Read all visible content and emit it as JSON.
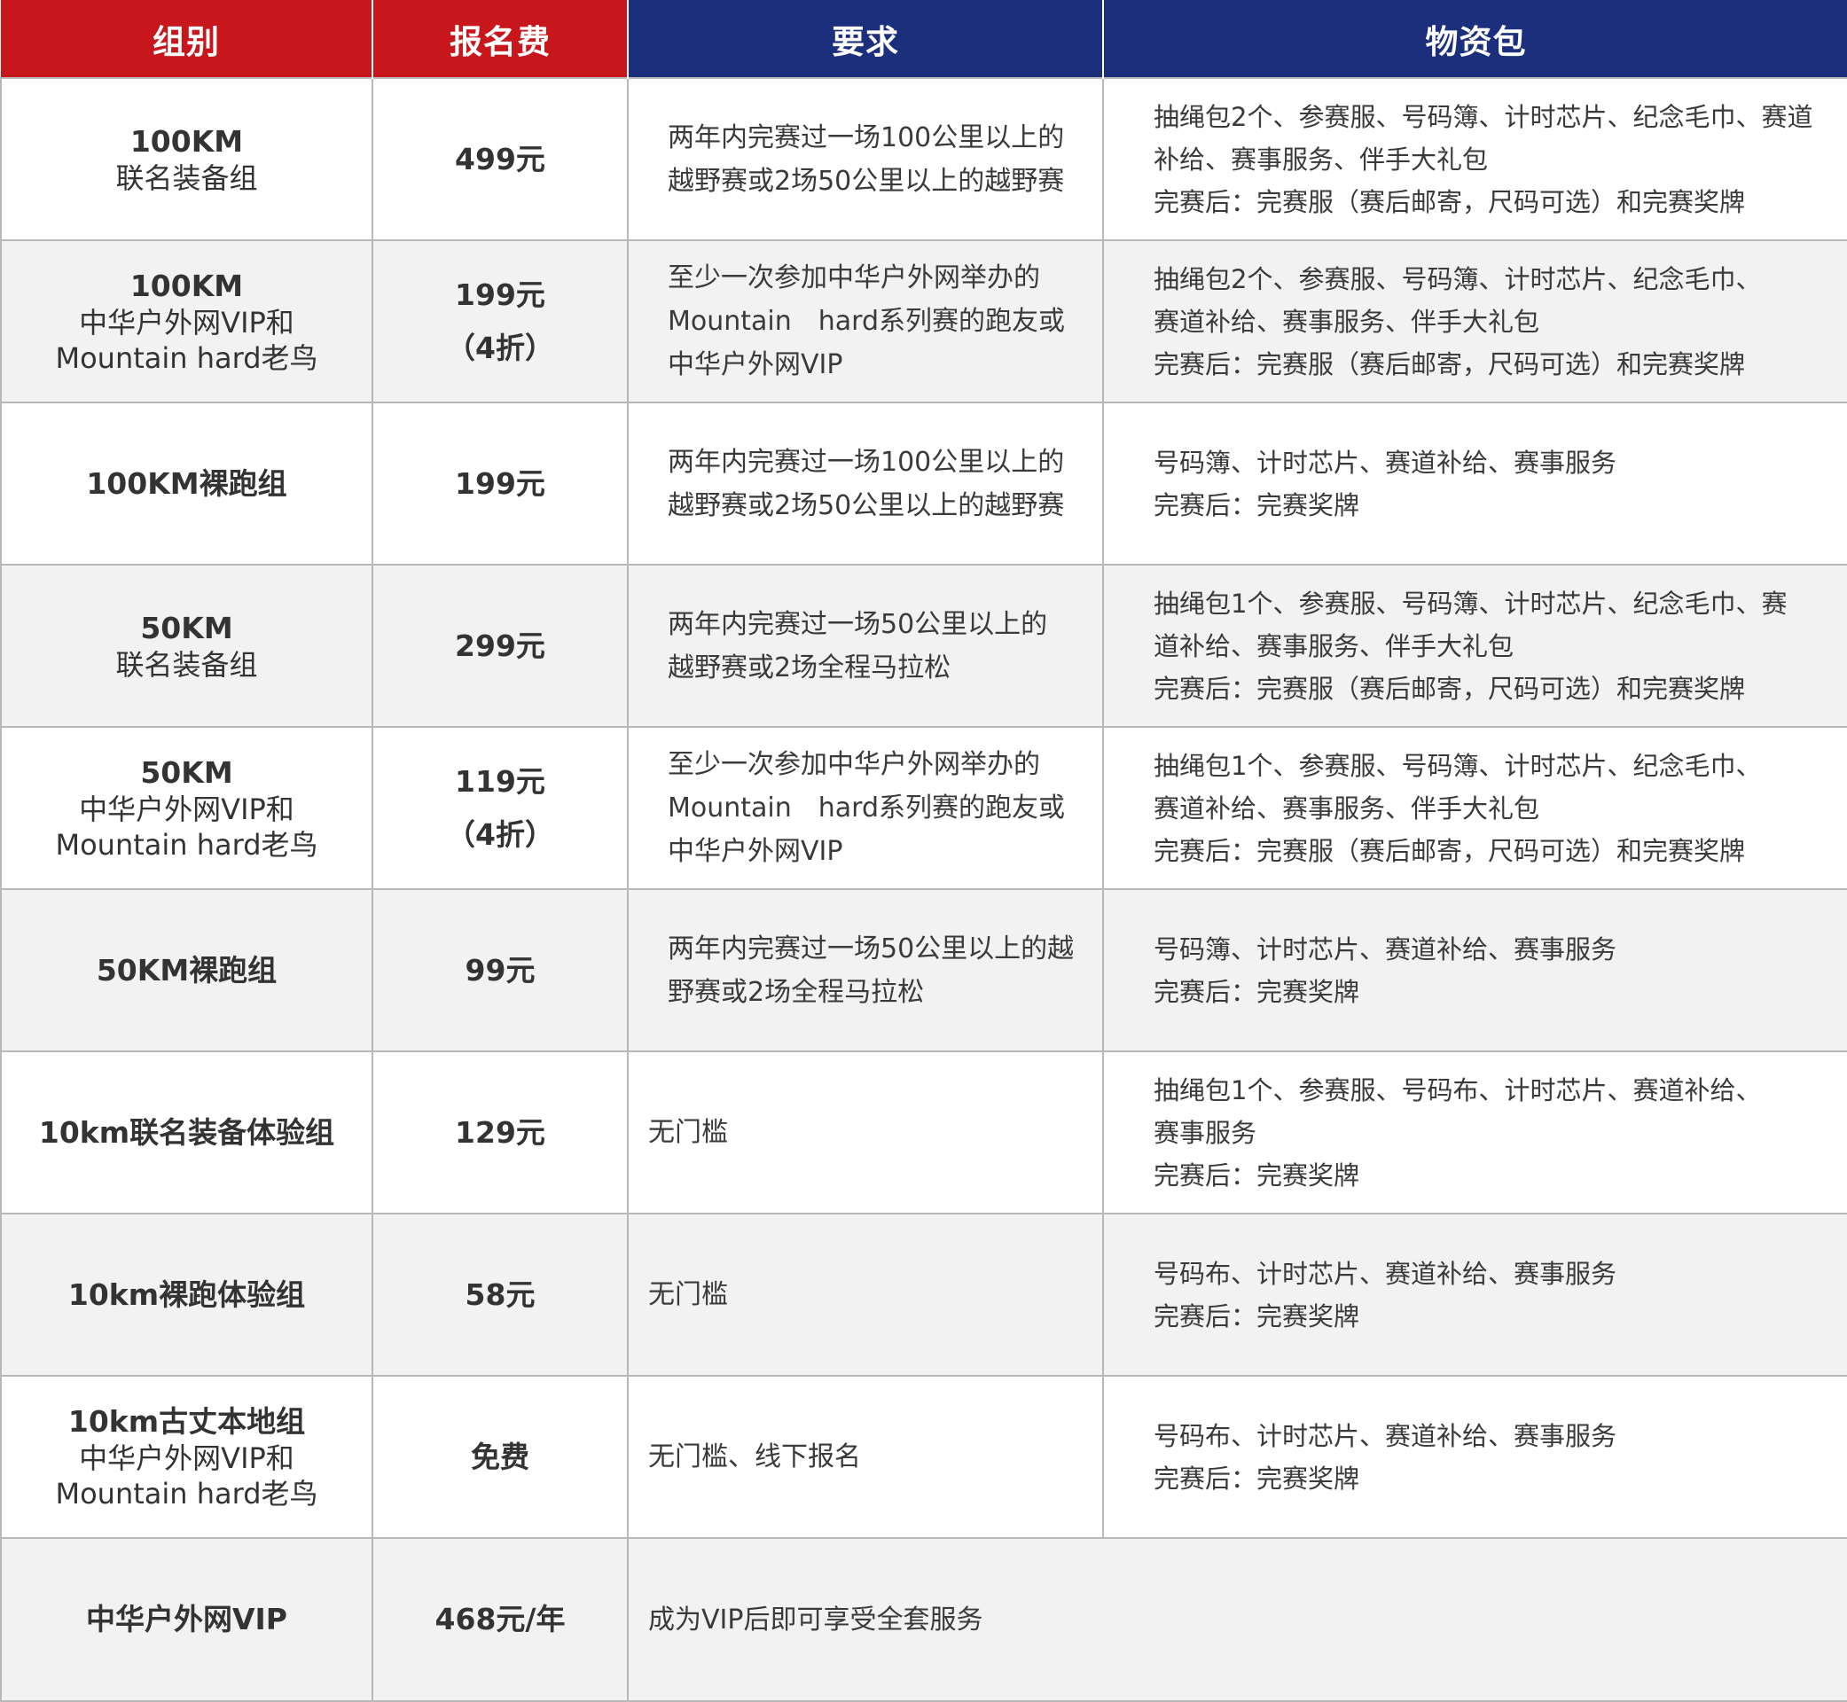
{
  "headers": {
    "group": "组别",
    "fee": "报名费",
    "requirement": "要求",
    "kit": "物资包"
  },
  "rows": [
    {
      "group": [
        "100KM",
        "联名装备组"
      ],
      "fee": [
        "499元"
      ],
      "requirement": [
        "两年内完赛过一场100公里以上的",
        "越野赛或2场50公里以上的越野赛"
      ],
      "kit": [
        "抽绳包2个、参赛服、号码簿、计时芯片、纪念毛巾、赛道",
        "补给、赛事服务、伴手大礼包",
        "完赛后：完赛服（赛后邮寄，尺码可选）和完赛奖牌"
      ]
    },
    {
      "group": [
        "100KM",
        "中华户外网VIP和",
        "Mountain hard老鸟"
      ],
      "fee": [
        "199元",
        "（4折）"
      ],
      "requirement": [
        "至少一次参加中华户外网举办的",
        "Mountain　hard系列赛的跑友或",
        "中华户外网VIP"
      ],
      "kit": [
        "抽绳包2个、参赛服、号码簿、计时芯片、纪念毛巾、",
        "赛道补给、赛事服务、伴手大礼包",
        "完赛后：完赛服（赛后邮寄，尺码可选）和完赛奖牌"
      ]
    },
    {
      "group": [
        "100KM裸跑组"
      ],
      "fee": [
        "199元"
      ],
      "requirement": [
        "两年内完赛过一场100公里以上的",
        "越野赛或2场50公里以上的越野赛"
      ],
      "kit": [
        "号码簿、计时芯片、赛道补给、赛事服务",
        "完赛后：完赛奖牌"
      ]
    },
    {
      "group": [
        "50KM",
        "联名装备组"
      ],
      "fee": [
        "299元"
      ],
      "requirement": [
        "两年内完赛过一场50公里以上的",
        "越野赛或2场全程马拉松"
      ],
      "kit": [
        "抽绳包1个、参赛服、号码簿、计时芯片、纪念毛巾、赛",
        "道补给、赛事服务、伴手大礼包",
        "完赛后：完赛服（赛后邮寄，尺码可选）和完赛奖牌"
      ]
    },
    {
      "group": [
        "50KM",
        "中华户外网VIP和",
        "Mountain hard老鸟"
      ],
      "fee": [
        "119元",
        "（4折）"
      ],
      "requirement": [
        "至少一次参加中华户外网举办的",
        "Mountain　hard系列赛的跑友或",
        "中华户外网VIP"
      ],
      "kit": [
        "抽绳包1个、参赛服、号码簿、计时芯片、纪念毛巾、",
        "赛道补给、赛事服务、伴手大礼包",
        "完赛后：完赛服（赛后邮寄，尺码可选）和完赛奖牌"
      ]
    },
    {
      "group": [
        "50KM裸跑组"
      ],
      "fee": [
        "99元"
      ],
      "requirement": [
        "两年内完赛过一场50公里以上的越",
        "野赛或2场全程马拉松"
      ],
      "kit": [
        "号码簿、计时芯片、赛道补给、赛事服务",
        "完赛后：完赛奖牌"
      ]
    },
    {
      "group": [
        "10km联名装备体验组"
      ],
      "fee": [
        "129元"
      ],
      "requirement": [
        "无门槛"
      ],
      "kit": [
        "抽绳包1个、参赛服、号码布、计时芯片、赛道补给、",
        "赛事服务",
        "完赛后：完赛奖牌"
      ]
    },
    {
      "group": [
        "10km裸跑体验组"
      ],
      "fee": [
        "58元"
      ],
      "requirement": [
        "无门槛"
      ],
      "kit": [
        "号码布、计时芯片、赛道补给、赛事服务",
        "完赛后：完赛奖牌"
      ]
    },
    {
      "group": [
        "10km古丈本地组",
        "中华户外网VIP和",
        "Mountain hard老鸟"
      ],
      "fee": [
        "免费"
      ],
      "requirement": [
        "无门槛、线下报名"
      ],
      "kit": [
        "号码布、计时芯片、赛道补给、赛事服务",
        "完赛后：完赛奖牌"
      ]
    },
    {
      "group": [
        "中华户外网VIP"
      ],
      "fee": [
        "468元/年"
      ],
      "requirement": [
        "成为VIP后即可享受全套服务"
      ],
      "kit": []
    }
  ]
}
